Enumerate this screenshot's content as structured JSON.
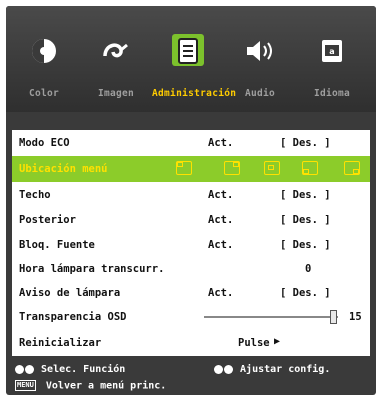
{
  "tabs": [
    {
      "label": "Color",
      "icon": "color-icon"
    },
    {
      "label": "Imagen",
      "icon": "image-icon"
    },
    {
      "label": "Administración",
      "icon": "management-icon",
      "active": true
    },
    {
      "label": "Audio",
      "icon": "speaker-icon"
    },
    {
      "label": "Idioma",
      "icon": "language-icon"
    }
  ],
  "rows": {
    "eco": {
      "label": "Modo ECO",
      "on": "Act.",
      "off": "[ Des. ]"
    },
    "menu_location": {
      "label": "Ubicación menú",
      "selected": true
    },
    "ceiling": {
      "label": "Techo",
      "on": "Act.",
      "off": "[ Des. ]"
    },
    "rear": {
      "label": "Posterior",
      "on": "Act.",
      "off": "[ Des. ]"
    },
    "source_lock": {
      "label": "Bloq. Fuente",
      "on": "Act.",
      "off": "[ Des. ]"
    },
    "lamp_hours": {
      "label": "Hora lámpara transcurr.",
      "value": "0"
    },
    "lamp_reminder": {
      "label": "Aviso de lámpara",
      "on": "Act.",
      "off": "[ Des. ]"
    },
    "osd_transparency": {
      "label": "Transparencia OSD",
      "value": "15",
      "level_fraction": 0.95
    },
    "reset": {
      "label": "Reinicializar",
      "action": "Pulse",
      "arrow": "▶"
    }
  },
  "footer": {
    "select_label": "Selec. Función",
    "adjust_label": "Ajustar config.",
    "menu_key": "MENU",
    "back_label": "Volver a menú princ."
  },
  "colors": {
    "accent_green": "#7cc12c",
    "highlight_yellow": "#ffcc00",
    "osd_bg": "#3a3a3a"
  }
}
